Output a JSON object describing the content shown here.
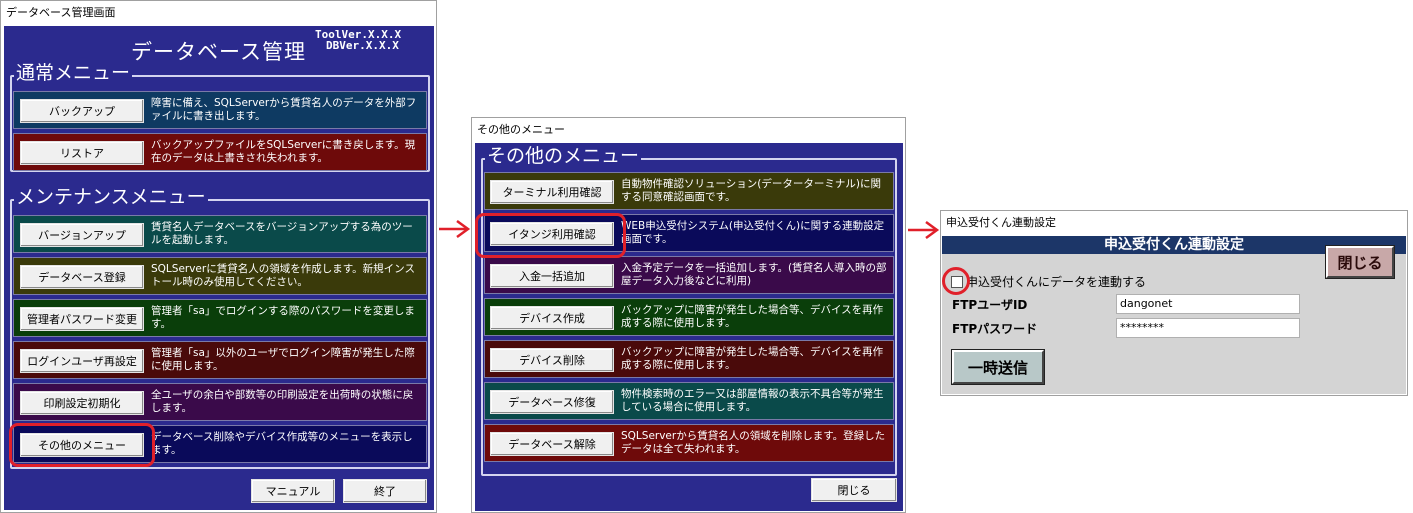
{
  "main_window": {
    "title": "データベース管理画面",
    "heading": "データベース管理",
    "tool_version": "ToolVer.X.X.X",
    "db_version": "DBVer.X.X.X",
    "normal_menu": {
      "label": "通常メニュー",
      "items": [
        {
          "button": "バックアップ",
          "desc": "障害に備え、SQLServerから賃貸名人のデータを外部ファイルに書き出します。",
          "color": "#0e3a62"
        },
        {
          "button": "リストア",
          "desc": "バックアップファイルをSQLServerに書き戻します。現在のデータは上書きされ失われます。",
          "color": "#6e0a0a"
        }
      ]
    },
    "maintenance_menu": {
      "label": "メンテナンスメニュー",
      "items": [
        {
          "button": "バージョンアップ",
          "desc": "賃貸名人データベースをバージョンアップする為のツールを起動します。",
          "color": "#0a4a4a"
        },
        {
          "button": "データベース登録",
          "desc": "SQLServerに賃貸名人の領域を作成します。新規インストール時のみ使用してください。",
          "color": "#3a3a0a"
        },
        {
          "button": "管理者パスワード変更",
          "desc": "管理者「sa」でログインする際のパスワードを変更します。",
          "color": "#0a3e0a"
        },
        {
          "button": "ログインユーザ再設定",
          "desc": "管理者「sa」以外のユーザでログイン障害が発生した際に使用します。",
          "color": "#4a0a0a"
        },
        {
          "button": "印刷設定初期化",
          "desc": "全ユーザの余白や部数等の印刷設定を出荷時の状態に戻します。",
          "color": "#3a0a4a"
        },
        {
          "button": "その他のメニュー",
          "desc": "データベース削除やデバイス作成等のメニューを表示します。",
          "color": "#0a0a5a"
        }
      ]
    },
    "manual_button": "マニュアル",
    "exit_button": "終了"
  },
  "other_window": {
    "title": "その他のメニュー",
    "group_label": "その他のメニュー",
    "items": [
      {
        "button": "ターミナル利用確認",
        "desc": "自動物件確認ソリューション(データーターミナル)に関する同意確認画面です。",
        "color": "#3a3a0a"
      },
      {
        "button": "イタンジ利用確認",
        "desc": "WEB申込受付システム(申込受付くん)に関する連動設定画面です。",
        "color": "#0a0a5a"
      },
      {
        "button": "入金一括追加",
        "desc": "入金予定データを一括追加します。(賃貸名人導入時の部屋データ入力後などに利用)",
        "color": "#3a0a4a"
      },
      {
        "button": "デバイス作成",
        "desc": "バックアップに障害が発生した場合等、デバイスを再作成する際に使用します。",
        "color": "#0a3e0a"
      },
      {
        "button": "デバイス削除",
        "desc": "バックアップに障害が発生した場合等、デバイスを再作成する際に使用します。",
        "color": "#4a0a0a"
      },
      {
        "button": "データベース修復",
        "desc": "物件検索時のエラー又は部屋情報の表示不具合等が発生している場合に使用します。",
        "color": "#0a4a4a"
      },
      {
        "button": "データベース解除",
        "desc": "SQLServerから賃貸名人の領域を削除します。登録したデータは全て失われます。",
        "color": "#6e0a0a"
      }
    ],
    "close_button": "閉じる"
  },
  "link_window": {
    "title": "申込受付くん連動設定",
    "heading": "申込受付くん連動設定",
    "close_button": "閉じる",
    "checkbox_label": "申込受付くんにデータを連動する",
    "ftp_user_label": "FTPユーザID",
    "ftp_user_value": "dangonet",
    "ftp_password_label": "FTPパスワード",
    "ftp_password_value": "********",
    "send_button": "一時送信"
  }
}
